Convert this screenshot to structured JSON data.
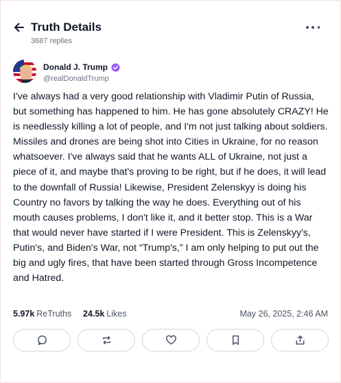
{
  "header": {
    "title": "Truth Details",
    "replies": "3687 replies",
    "back_icon": "arrow-left-icon",
    "more_icon": "more-horizontal-icon"
  },
  "author": {
    "name": "Donald J. Trump",
    "handle": "@realDonaldTrump",
    "verified": true,
    "verified_color": "#9b5cf6"
  },
  "post": {
    "text": "I've always had a very good relationship with Vladimir Putin of Russia, but something has happened to him. He has gone absolutely CRAZY! He is needlessly killing a lot of people, and I'm not just talking about soldiers. Missiles and drones are being shot into Cities in Ukraine, for no reason whatsoever. I've always said that he wants ALL of Ukraine, not just a piece of it, and maybe that's proving to be right, but if he does, it will lead to the downfall of Russia! Likewise, President Zelenskyy is doing his Country no favors by talking the way he does. Everything out of his mouth causes problems, I don't like it, and it better stop. This is a War that would never have started if I were President. This is Zelenskyy's, Putin's, and Biden's War, not “Trump's,” I am only helping to put out the big and ugly fires, that have been started through Gross Incompetence and Hatred."
  },
  "stats": {
    "retruths_count": "5.97k",
    "retruths_label": "ReTruths",
    "likes_count": "24.5k",
    "likes_label": "Likes",
    "timestamp": "May 26, 2025, 2:46 AM"
  },
  "actions": [
    {
      "icon": "reply-icon"
    },
    {
      "icon": "retruth-icon"
    },
    {
      "icon": "heart-icon"
    },
    {
      "icon": "bookmark-icon"
    },
    {
      "icon": "share-icon"
    }
  ]
}
